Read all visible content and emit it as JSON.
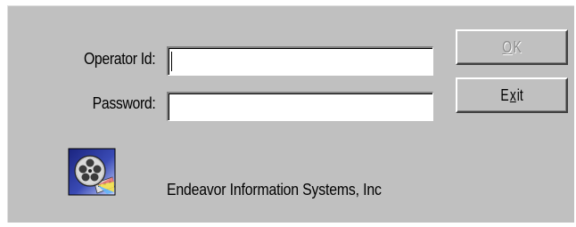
{
  "login_dialog": {
    "operator_label": "Operator Id:",
    "operator_value": "",
    "password_label": "Password:",
    "password_value": "",
    "ok_button": {
      "mnemonic": "O",
      "rest": "K"
    },
    "exit_button": {
      "before": "E",
      "mnemonic": "x",
      "after": "it"
    },
    "company_name": "Endeavor Information Systems, Inc",
    "logo_icon": "film-reel-icon"
  },
  "colors": {
    "dialog_background": "#c0c0c0",
    "disabled_text": "#8c8c8c",
    "text": "#000000",
    "field_background": "#ffffff"
  }
}
